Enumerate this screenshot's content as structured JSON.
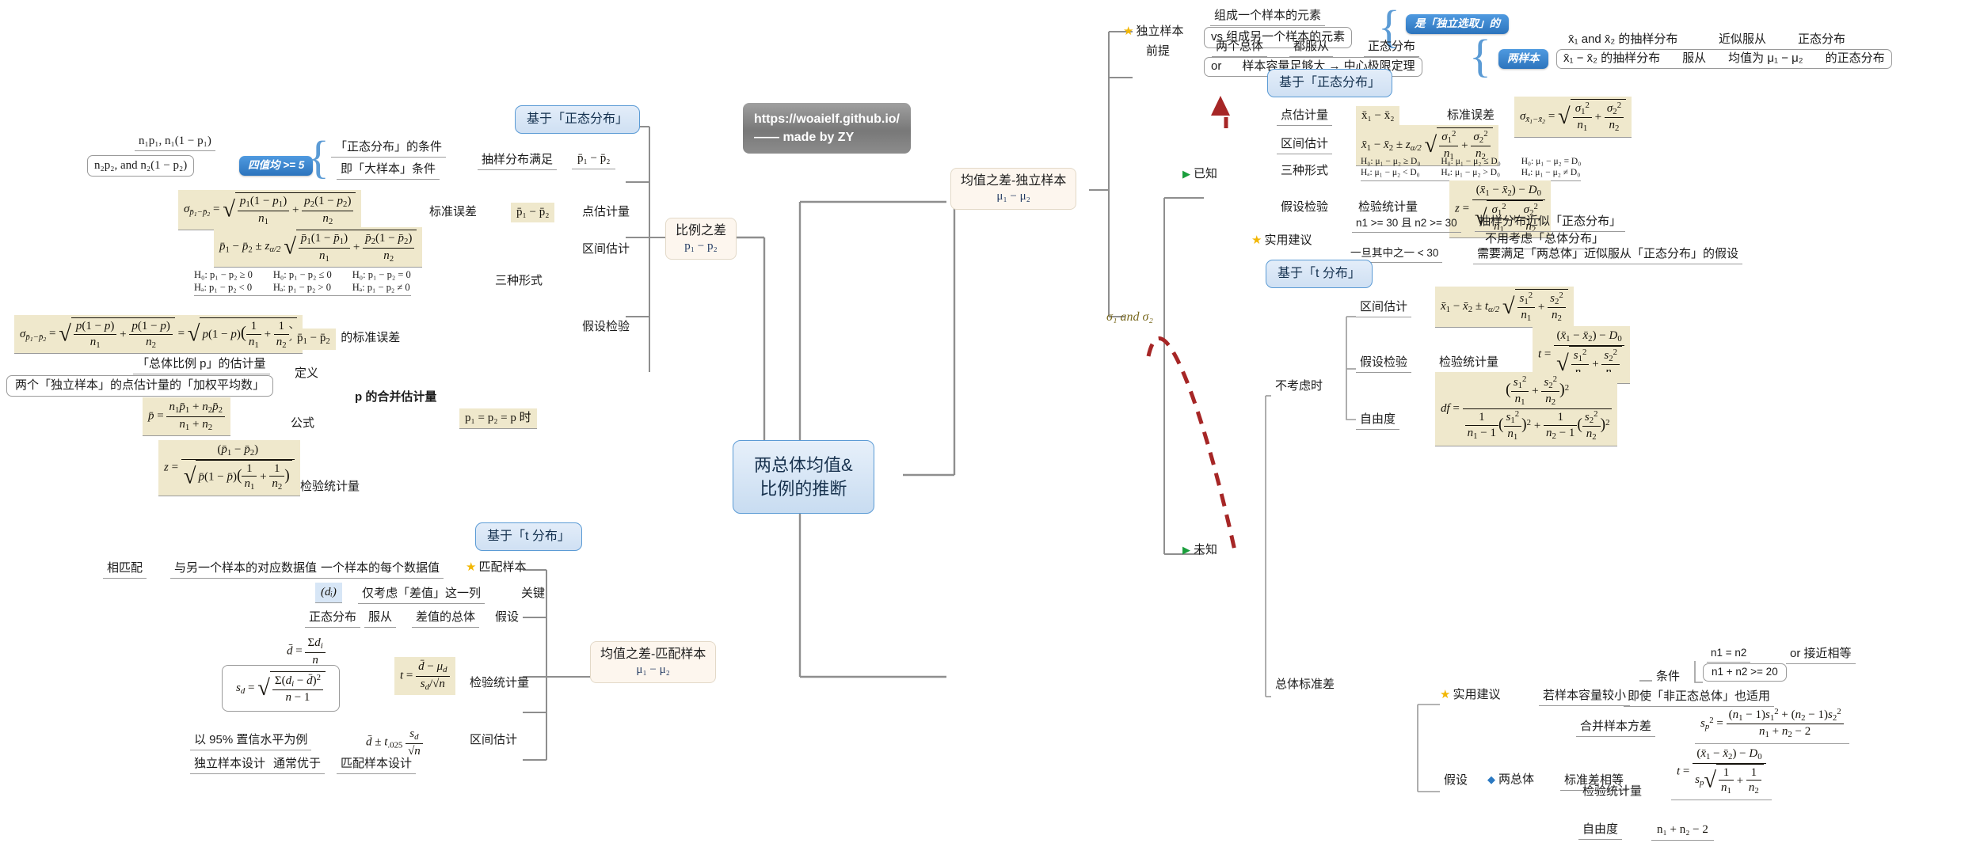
{
  "meta": {
    "root_title_line1": "两总体均值&",
    "root_title_line2": "比例的推断",
    "watermark_line1": "https://woaielf.github.io/",
    "watermark_line2": "—— made by ZY",
    "accent_blue": "#5b9bd5",
    "formula_bg": "#efe8cc",
    "cream_bg": "#fdf6ee",
    "star_color": "#f2b705",
    "flag_color": "#1a9e3c",
    "arrow_color": "#a62626"
  },
  "left": {
    "hub_proportion": {
      "title": "比例之差",
      "sub": "p₁ − p₂"
    },
    "hub_matched": {
      "title": "均值之差-匹配样本",
      "sub": "μ₁ − μ₂"
    },
    "normal_box": "基于「正态分布」",
    "t_box": "基于「t 分布」",
    "prop": {
      "cond_values_1": "n₁p₁, n₁(1 − p₁)",
      "cond_values_2": "n₂p₂, and n₂(1 − p₂)",
      "pill_four_values": "四值均 >= 5",
      "cond_normal": "「正态分布」的条件",
      "cond_large": "即「大样本」条件",
      "sampling_ok": "抽样分布满足",
      "sampling_target": "p̄₁ − p̄₂",
      "se_label": "标准误差",
      "se_target": "p̄₁ − p̄₂",
      "point_est_label": "点估计量",
      "interval_label": "区间估计",
      "hypo_label": "假设检验",
      "three_forms_label": "三种形式",
      "se_pooled_label": "p̄₁ − p̄₂ 的标准误差",
      "pooled_title": "p 的合并估计量",
      "pooled_def_label": "定义",
      "pooled_formula_label": "公式",
      "pooled_est_of": "「总体比例 p」的估计量",
      "pooled_weighted": "两个「独立样本」的点估计量的「加权平均数」",
      "test_stat_label": "检验统计量",
      "when_equal": "p₁ = p₂ = p 时",
      "hypotheses": [
        {
          "h0": "H₀: p₁ − p₂ ≥ 0",
          "ha": "Hₐ: p₁ − p₂ < 0"
        },
        {
          "h0": "H₀: p₁ − p₂ ≤ 0",
          "ha": "Hₐ: p₁ − p₂ > 0"
        },
        {
          "h0": "H₀: p₁ − p₂ = 0",
          "ha": "Hₐ: p₁ − p₂ ≠ 0"
        }
      ]
    },
    "matched": {
      "pair_a": "相匹配",
      "pair_b": "与另一个样本的对应数据值",
      "pair_c": "一个样本的每个数据值",
      "star_label": "匹配样本",
      "di": "(dᵢ)",
      "only_diff": "仅考虑「差值」这一列",
      "key": "关键",
      "normal": "正态分布",
      "follow": "服从",
      "diff_pop": "差值的总体",
      "assume": "假设",
      "test_stat_label": "检验统计量",
      "interval_label": "区间估计",
      "ci_example": "以 95% 置信水平为例",
      "design_a": "独立样本设计",
      "design_mid": "通常优于",
      "design_b": "匹配样本设计"
    }
  },
  "right": {
    "hub_independent": {
      "title": "均值之差-独立样本",
      "sub": "μ₁ − μ₂"
    },
    "sigma_branch_label": "σ₁ and σ₂",
    "known_label": "已知",
    "unknown_label": "未知",
    "normal_box": "基于「正态分布」",
    "t_box": "基于「t 分布」",
    "independent": {
      "title": "独立样本",
      "elem_a": "组成一个样本的元素",
      "elem_b": "vs 组成另一个样本的元素",
      "pill": "是「独立选取」的"
    },
    "premise": {
      "label": "前提",
      "row_a1": "两个总体",
      "row_a2": "都服从",
      "row_a3": "正态分布",
      "row_b1": "or",
      "row_b2": "样本容量足够大 → 中心极限定理",
      "pill": "两样本",
      "dist_a1": "x̄₁ and x̄₂ 的抽样分布",
      "dist_a2": "近似服从",
      "dist_a3": "正态分布",
      "dist_b1": "x̄₁ − x̄₂ 的抽样分布",
      "dist_b2": "服从",
      "dist_b3": "均值为 μ₁ − μ₂",
      "dist_b4": "的正态分布"
    },
    "known": {
      "point_est_label": "点估计量",
      "point_est": "x̄₁ − x̄₂",
      "se_label": "标准误差",
      "interval_label": "区间估计",
      "hypo_label": "假设检验",
      "three_forms_label": "三种形式",
      "test_stat_label": "检验统计量",
      "hypotheses": [
        {
          "h0": "H₀: μ₁ − μ₂ ≥ D₀",
          "ha": "Hₐ: μ₁ − μ₂ < D₀"
        },
        {
          "h0": "H₀: μ₁ − μ₂ ≤ D₀",
          "ha": "Hₐ: μ₁ − μ₂ > D₀"
        },
        {
          "h0": "H₀: μ₁ − μ₂ = D₀",
          "ha": "Hₐ: μ₁ − μ₂ ≠ D₀"
        }
      ]
    },
    "advice_top": {
      "title": "实用建议",
      "cond": "n1 >= 30 且 n2 >= 30",
      "res_a": "抽样分布近似「正态分布」",
      "res_b": "不用考虑「总体分布」",
      "cond2": "一旦其中之一 < 30",
      "res_c": "需要满足「两总体」近似服从「正态分布」的假设"
    },
    "unknown": {
      "interval_label": "区间估计",
      "hypo_label": "假设检验",
      "test_stat_label": "检验统计量",
      "df_label": "自由度",
      "not_considered": "不考虑时",
      "pooled_sd_label": "总体标准差",
      "assume_label": "假设",
      "two_pop": "两总体",
      "equal_sd": "标准差相等",
      "pooled_var_label": "合并样本方差",
      "df_label2": "自由度",
      "df_value": "n₁ + n₂ − 2"
    },
    "advice_bottom": {
      "title": "实用建议",
      "small_n": "若样本容量较小",
      "cond_label": "条件",
      "cond_a": "n1 = n2",
      "cond_a2": "or 接近相等",
      "cond_b": "n1 + n2 >= 20",
      "result": "即使「非正态总体」也适用"
    }
  }
}
